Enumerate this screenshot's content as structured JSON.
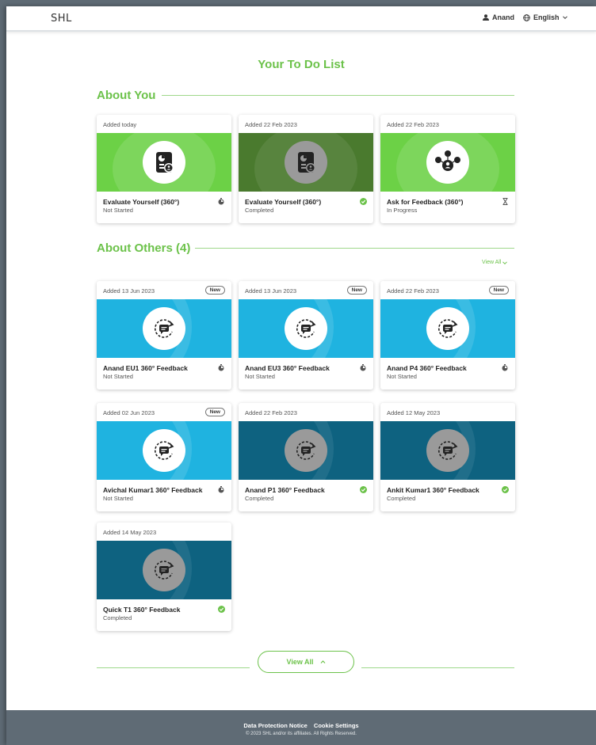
{
  "header": {
    "logo": "SHL",
    "user_name": "Anand",
    "language": "English"
  },
  "page_title": "Your To Do List",
  "sections": {
    "about_you": "About You",
    "about_others": "About Others (4)",
    "view_all_link": "View All"
  },
  "cards": [
    {
      "added": "Added today",
      "badge": "",
      "name": "Evaluate Yourself (360°)",
      "status": "Not Started"
    },
    {
      "added": "Added 22 Feb 2023",
      "badge": "",
      "name": "Evaluate Yourself (360°)",
      "status": "Completed"
    },
    {
      "added": "Added 22 Feb 2023",
      "badge": "",
      "name": "Ask for Feedback (360°)",
      "status": "In Progress"
    },
    {
      "added": "Added 13 Jun 2023",
      "badge": "New",
      "name": "Anand EU1 360° Feedback",
      "status": "Not Started"
    },
    {
      "added": "Added 13 Jun 2023",
      "badge": "New",
      "name": "Anand EU3 360° Feedback",
      "status": "Not Started"
    },
    {
      "added": "Added 22 Feb 2023",
      "badge": "New",
      "name": "Anand P4 360° Feedback",
      "status": "Not Started"
    },
    {
      "added": "Added 02 Jun 2023",
      "badge": "New",
      "name": "Avichal Kumar1 360° Feedback",
      "status": "Not Started"
    },
    {
      "added": "Added 22 Feb 2023",
      "badge": "",
      "name": "Anand P1 360° Feedback",
      "status": "Completed"
    },
    {
      "added": "Added 12 May 2023",
      "badge": "",
      "name": "Ankit Kumar1 360° Feedback",
      "status": "Completed"
    },
    {
      "added": "Added 14 May 2023",
      "badge": "",
      "name": "Quick T1 360° Feedback",
      "status": "Completed"
    }
  ],
  "view_all_button": "View All",
  "footer": {
    "data_protection": "Data Protection Notice",
    "cookie_settings": "Cookie Settings",
    "copyright": "© 2023 SHL and/or its affiliates. All Rights Reserved."
  },
  "colors": {
    "accent_green": "#6cc24a",
    "dark_green": "#4a7a2e",
    "light_blue": "#1fb3e0",
    "dark_blue": "#0e6280",
    "footer_grey": "#5f6b75"
  }
}
